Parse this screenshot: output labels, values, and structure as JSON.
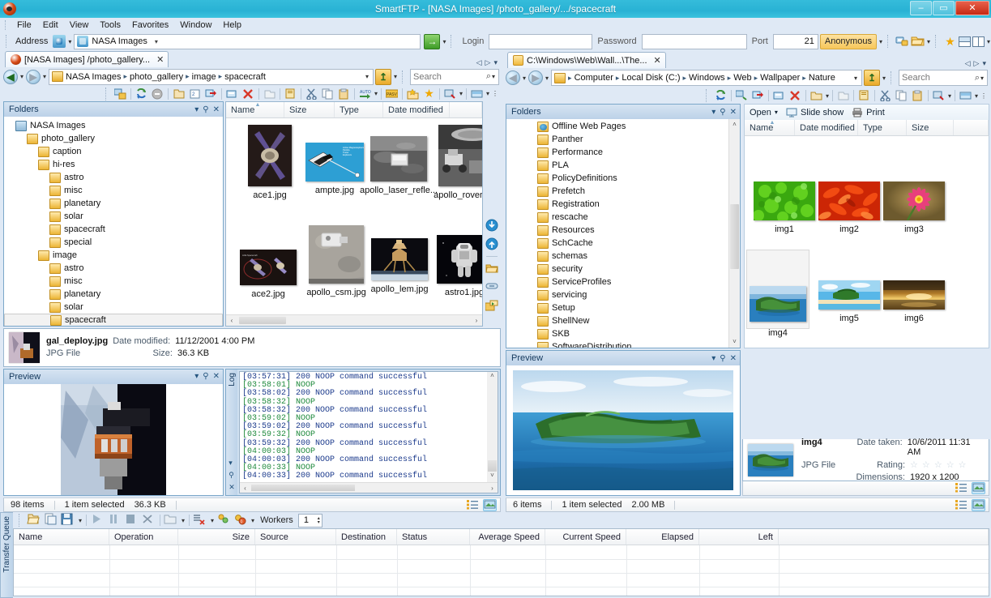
{
  "window": {
    "title": "SmartFTP - [NASA Images] /photo_gallery/.../spacecraft",
    "app_icon": "smartftp-icon",
    "minimize": "–",
    "maximize": "▭",
    "close": "✕"
  },
  "menu": {
    "items": [
      "File",
      "Edit",
      "View",
      "Tools",
      "Favorites",
      "Window",
      "Help"
    ]
  },
  "address_bar": {
    "label": "Address",
    "value": "NASA Images",
    "go_label": "→",
    "login_label": "Login",
    "login_value": "",
    "password_label": "Password",
    "password_value": "",
    "port_label": "Port",
    "port_value": "21",
    "anonymous_label": "Anonymous",
    "star_icon": "favorites-star-icon",
    "layout_h_icon": "layout-horizontal-icon",
    "layout_v_icon": "layout-vertical-icon"
  },
  "left_pane": {
    "tab": {
      "label": "[NASA Images] /photo_gallery...",
      "close": "✕",
      "icon": "smartftp-icon"
    },
    "nav": {
      "back_icon": "back-arrow-icon",
      "forward_icon": "forward-arrow-icon",
      "crumbs": [
        "NASA Images",
        "photo_gallery",
        "image",
        "spacecraft"
      ],
      "separator": "▸",
      "up_icon": "up-arrow-icon",
      "search_placeholder": "Search"
    },
    "folders_dock": {
      "title": "Folders",
      "menu_icon": "chevron-down-icon",
      "pin_icon": "pin-icon",
      "close_icon": "close-icon",
      "tree": [
        {
          "label": "NASA Images",
          "depth": 0,
          "icon": "computer-icon",
          "selected": false
        },
        {
          "label": "photo_gallery",
          "depth": 1,
          "icon": "folder-icon",
          "selected": false
        },
        {
          "label": "caption",
          "depth": 2,
          "icon": "folder-icon",
          "selected": false
        },
        {
          "label": "hi-res",
          "depth": 2,
          "icon": "folder-icon",
          "selected": false
        },
        {
          "label": "astro",
          "depth": 3,
          "icon": "folder-icon",
          "selected": false
        },
        {
          "label": "misc",
          "depth": 3,
          "icon": "folder-icon",
          "selected": false
        },
        {
          "label": "planetary",
          "depth": 3,
          "icon": "folder-icon",
          "selected": false
        },
        {
          "label": "solar",
          "depth": 3,
          "icon": "folder-icon",
          "selected": false
        },
        {
          "label": "spacecraft",
          "depth": 3,
          "icon": "folder-icon",
          "selected": false
        },
        {
          "label": "special",
          "depth": 3,
          "icon": "folder-icon",
          "selected": false
        },
        {
          "label": "image",
          "depth": 2,
          "icon": "folder-icon",
          "selected": false
        },
        {
          "label": "astro",
          "depth": 3,
          "icon": "folder-icon",
          "selected": false
        },
        {
          "label": "misc",
          "depth": 3,
          "icon": "folder-icon",
          "selected": false
        },
        {
          "label": "planetary",
          "depth": 3,
          "icon": "folder-icon",
          "selected": false
        },
        {
          "label": "solar",
          "depth": 3,
          "icon": "folder-icon",
          "selected": false
        },
        {
          "label": "spacecraft",
          "depth": 3,
          "icon": "folder-icon",
          "selected": true
        }
      ]
    },
    "columns": [
      "Name",
      "Size",
      "Type",
      "Date modified"
    ],
    "files": [
      {
        "name": "ace1.jpg"
      },
      {
        "name": "ampte.jpg"
      },
      {
        "name": "apollo_laser_refle..."
      },
      {
        "name": "apollo_rover.jpg"
      },
      {
        "name": "ace2.jpg"
      },
      {
        "name": "apollo_csm.jpg"
      },
      {
        "name": "apollo_lem.jpg"
      },
      {
        "name": "astro1.jpg"
      }
    ],
    "detail": {
      "name": "gal_deploy.jpg",
      "type": "JPG File",
      "date_label": "Date modified:",
      "date_value": "11/12/2001 4:00 PM",
      "size_label": "Size:",
      "size_value": "36.3 KB"
    },
    "preview_dock": {
      "title": "Preview",
      "menu_icon": "chevron-down-icon",
      "pin_icon": "pin-icon",
      "close_icon": "close-icon"
    },
    "log_dock": {
      "title": "Log",
      "lines": [
        {
          "time": "[03:57:31]",
          "text": "200 NOOP command successful",
          "kind": "response"
        },
        {
          "time": "[03:58:01]",
          "text": "NOOP",
          "kind": "command"
        },
        {
          "time": "[03:58:02]",
          "text": "200 NOOP command successful",
          "kind": "response"
        },
        {
          "time": "[03:58:32]",
          "text": "NOOP",
          "kind": "command"
        },
        {
          "time": "[03:58:32]",
          "text": "200 NOOP command successful",
          "kind": "response"
        },
        {
          "time": "[03:59:02]",
          "text": "NOOP",
          "kind": "command"
        },
        {
          "time": "[03:59:02]",
          "text": "200 NOOP command successful",
          "kind": "response"
        },
        {
          "time": "[03:59:32]",
          "text": "NOOP",
          "kind": "command"
        },
        {
          "time": "[03:59:32]",
          "text": "200 NOOP command successful",
          "kind": "response"
        },
        {
          "time": "[04:00:03]",
          "text": "NOOP",
          "kind": "command"
        },
        {
          "time": "[04:00:03]",
          "text": "200 NOOP command successful",
          "kind": "response"
        },
        {
          "time": "[04:00:33]",
          "text": "NOOP",
          "kind": "command"
        },
        {
          "time": "[04:00:33]",
          "text": "200 NOOP command successful",
          "kind": "response"
        }
      ]
    },
    "status": {
      "items_count": "98 items",
      "selection": "1 item selected",
      "selection_size": "36.3 KB"
    }
  },
  "right_pane": {
    "tab": {
      "label": "C:\\Windows\\Web\\Wall...\\The...",
      "close": "✕",
      "icon": "folder-icon"
    },
    "nav": {
      "crumbs": [
        "Computer",
        "Local Disk (C:)",
        "Windows",
        "Web",
        "Wallpaper",
        "Nature"
      ],
      "separator": "▸",
      "search_placeholder": "Search"
    },
    "folders_dock": {
      "title": "Folders",
      "tree": [
        {
          "label": "Offline Web Pages",
          "icon": "offline-web-icon"
        },
        {
          "label": "Panther",
          "icon": "folder-icon"
        },
        {
          "label": "Performance",
          "icon": "folder-icon"
        },
        {
          "label": "PLA",
          "icon": "folder-icon"
        },
        {
          "label": "PolicyDefinitions",
          "icon": "folder-icon"
        },
        {
          "label": "Prefetch",
          "icon": "folder-icon"
        },
        {
          "label": "Registration",
          "icon": "folder-icon"
        },
        {
          "label": "rescache",
          "icon": "folder-icon"
        },
        {
          "label": "Resources",
          "icon": "folder-icon"
        },
        {
          "label": "SchCache",
          "icon": "folder-icon"
        },
        {
          "label": "schemas",
          "icon": "folder-icon"
        },
        {
          "label": "security",
          "icon": "folder-icon"
        },
        {
          "label": "ServiceProfiles",
          "icon": "folder-icon"
        },
        {
          "label": "servicing",
          "icon": "folder-icon"
        },
        {
          "label": "Setup",
          "icon": "folder-icon"
        },
        {
          "label": "ShellNew",
          "icon": "folder-icon"
        },
        {
          "label": "SKB",
          "icon": "folder-icon"
        },
        {
          "label": "SoftwareDistribution",
          "icon": "folder-icon"
        }
      ]
    },
    "command_bar": {
      "open_label": "Open",
      "open_caret": "▾",
      "slideshow_label": "Slide show",
      "slideshow_icon": "slideshow-icon",
      "print_label": "Print",
      "print_icon": "printer-icon"
    },
    "columns": [
      "Name",
      "Date modified",
      "Type",
      "Size"
    ],
    "files": [
      {
        "name": "img1"
      },
      {
        "name": "img2"
      },
      {
        "name": "img3"
      },
      {
        "name": "img4"
      },
      {
        "name": "img5"
      },
      {
        "name": "img6"
      }
    ],
    "preview_dock": {
      "title": "Preview",
      "menu_icon": "chevron-down-icon",
      "pin_icon": "pin-icon",
      "close_icon": "close-icon"
    },
    "detail": {
      "name": "img4",
      "type": "JPG File",
      "date_label": "Date taken:",
      "date_value": "10/6/2011 11:31 AM",
      "rating_label": "Rating:",
      "rating_stars": "☆ ☆ ☆ ☆ ☆",
      "dimensions_label": "Dimensions:",
      "dimensions_value": "1920 x 1200"
    },
    "status": {
      "items_count": "6 items",
      "selection": "1 item selected",
      "selection_size": "2.00 MB"
    }
  },
  "transfer_queue": {
    "title": "Transfer Queue",
    "workers_label": "Workers",
    "workers_value": "1",
    "columns": [
      "Name",
      "Operation",
      "Size",
      "Source",
      "Destination",
      "Status",
      "Average Speed",
      "Current Speed",
      "Elapsed",
      "Left"
    ]
  },
  "colors": {
    "title_bar": "#2fb8d8",
    "close_button": "#c52a13",
    "anonymous_badge": "#f7c75b",
    "log_response": "#1b3a8c",
    "log_command": "#1f8a3c",
    "chrome": "#dfe9f5"
  }
}
